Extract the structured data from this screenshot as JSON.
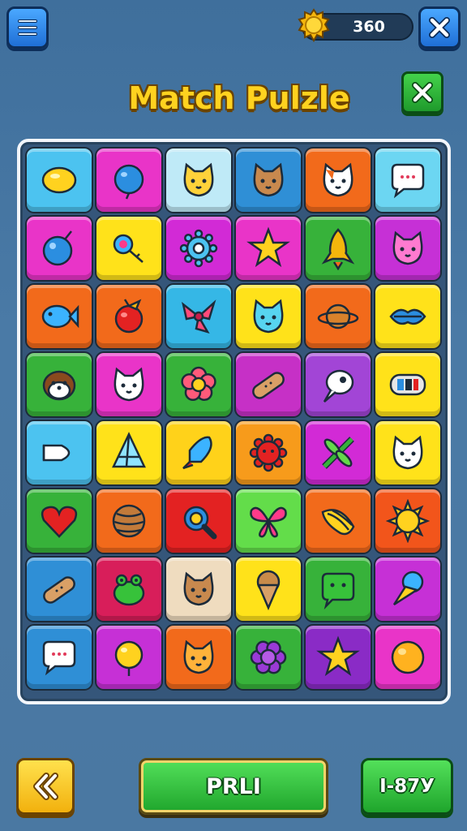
{
  "header": {
    "menu_icon": "hamburger-icon",
    "coin_icon": "coin-icon",
    "coins": "360",
    "close_icon": "close-icon"
  },
  "title": "Match Pulzle",
  "title_close_icon": "close-icon",
  "board": {
    "rows": 8,
    "cols": 6,
    "tiles": [
      {
        "icon": "lemon",
        "color": "#4cc3f0"
      },
      {
        "icon": "blue-balloon",
        "color": "#e934c8"
      },
      {
        "icon": "yellow-cat-face",
        "color": "#bfeaf7"
      },
      {
        "icon": "brown-cat-face",
        "color": "#2f8fd6"
      },
      {
        "icon": "calico-cat-face",
        "color": "#f26a1b"
      },
      {
        "icon": "speech-bubble",
        "color": "#6cd6f2"
      },
      {
        "icon": "blue-ornament",
        "color": "#e934c8"
      },
      {
        "icon": "magnifier-key",
        "color": "#ffe21a"
      },
      {
        "icon": "blue-gear-flower",
        "color": "#d22ad6"
      },
      {
        "icon": "star",
        "color": "#e934c8"
      },
      {
        "icon": "rocket",
        "color": "#37b23a"
      },
      {
        "icon": "pink-cat-face",
        "color": "#c630d6"
      },
      {
        "icon": "blue-fish",
        "color": "#f26a1b"
      },
      {
        "icon": "red-apple",
        "color": "#f26a1b"
      },
      {
        "icon": "pink-bow",
        "color": "#35b7e6"
      },
      {
        "icon": "cyan-cat-face",
        "color": "#ffe21a"
      },
      {
        "icon": "planet",
        "color": "#f26a1b"
      },
      {
        "icon": "blue-lips",
        "color": "#ffe21a"
      },
      {
        "icon": "otter-face",
        "color": "#37b23a"
      },
      {
        "icon": "white-cat-face",
        "color": "#e934c8"
      },
      {
        "icon": "flower",
        "color": "#37b23a"
      },
      {
        "icon": "bandage",
        "color": "#c630c6"
      },
      {
        "icon": "white-fish-ghost",
        "color": "#a245d6"
      },
      {
        "icon": "radio-device",
        "color": "#ffe21a"
      },
      {
        "icon": "white-cone",
        "color": "#4cc3f0"
      },
      {
        "icon": "crystal-pyramid",
        "color": "#ffe21a"
      },
      {
        "icon": "blue-rocket",
        "color": "#ffd21a"
      },
      {
        "icon": "red-sun",
        "color": "#f79b1b"
      },
      {
        "icon": "green-dragonfly",
        "color": "#d22ad6"
      },
      {
        "icon": "white-cat-face",
        "color": "#ffe21a"
      },
      {
        "icon": "heart",
        "color": "#37b23a"
      },
      {
        "icon": "wooden-ball",
        "color": "#f26a1b"
      },
      {
        "icon": "blue-magnifier",
        "color": "#e32222"
      },
      {
        "icon": "pink-butterfly",
        "color": "#63dd4a"
      },
      {
        "icon": "yellow-shell",
        "color": "#f26a1b"
      },
      {
        "icon": "yellow-sun",
        "color": "#f2551b"
      },
      {
        "icon": "bandage",
        "color": "#2f8fd6"
      },
      {
        "icon": "green-frog",
        "color": "#d81e5a"
      },
      {
        "icon": "brown-cat-face",
        "color": "#efdcbf"
      },
      {
        "icon": "ice-cream-cone",
        "color": "#ffe21a"
      },
      {
        "icon": "green-chat-face",
        "color": "#37b23a"
      },
      {
        "icon": "ice-cream-blue",
        "color": "#c630d6"
      },
      {
        "icon": "speech-bubble",
        "color": "#2f8fd6"
      },
      {
        "icon": "yellow-balloon",
        "color": "#c630d6"
      },
      {
        "icon": "orange-cat-face",
        "color": "#f26a1b"
      },
      {
        "icon": "purple-flower",
        "color": "#37b23a"
      },
      {
        "icon": "star",
        "color": "#8a2bc6"
      },
      {
        "icon": "orange-ball",
        "color": "#e934c8"
      }
    ]
  },
  "footer": {
    "back_icon": "double-chevron-left-icon",
    "play_label": "PRLI",
    "next_label": "I-87У"
  }
}
